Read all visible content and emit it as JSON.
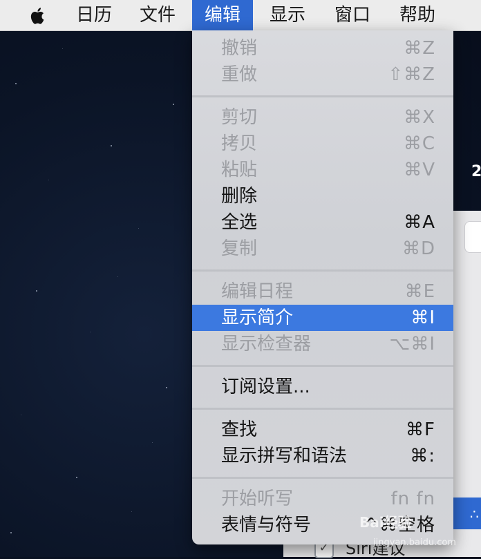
{
  "menubar": {
    "items": [
      {
        "label": "日历"
      },
      {
        "label": "文件"
      },
      {
        "label": "编辑"
      },
      {
        "label": "显示"
      },
      {
        "label": "窗口"
      },
      {
        "label": "帮助"
      }
    ],
    "active_index": 2
  },
  "edit_menu": {
    "items": [
      {
        "label": "撤销",
        "shortcut": "⌘Z",
        "enabled": false
      },
      {
        "label": "重做",
        "shortcut": "⇧⌘Z",
        "enabled": false
      },
      {
        "label": "剪切",
        "shortcut": "⌘X",
        "enabled": false
      },
      {
        "label": "拷贝",
        "shortcut": "⌘C",
        "enabled": false
      },
      {
        "label": "粘贴",
        "shortcut": "⌘V",
        "enabled": false
      },
      {
        "label": "删除",
        "shortcut": "",
        "enabled": true
      },
      {
        "label": "全选",
        "shortcut": "⌘A",
        "enabled": true
      },
      {
        "label": "复制",
        "shortcut": "⌘D",
        "enabled": false
      },
      {
        "label": "编辑日程",
        "shortcut": "⌘E",
        "enabled": false
      },
      {
        "label": "显示简介",
        "shortcut": "⌘I",
        "enabled": true,
        "highlighted": true
      },
      {
        "label": "显示检查器",
        "shortcut": "⌥⌘I",
        "enabled": false
      },
      {
        "label": "订阅设置...",
        "shortcut": "",
        "enabled": true
      },
      {
        "label": "查找",
        "shortcut": "⌘F",
        "enabled": true
      },
      {
        "label": "显示拼写和语法",
        "shortcut": "⌘:",
        "enabled": true
      },
      {
        "label": "开始听写",
        "shortcut": "fn fn",
        "enabled": false
      },
      {
        "label": "表情与符号",
        "shortcut": "^⌘空格",
        "enabled": true
      }
    ]
  },
  "background_app": {
    "partial_number": "2",
    "siri_label": "Siri建议",
    "siri_checked": true
  },
  "watermark": {
    "text": "Bai经验",
    "sub": "jingyan.baidu.com"
  },
  "colors": {
    "highlight": "#3c79e0",
    "menubar_active": "#2f69d1"
  }
}
